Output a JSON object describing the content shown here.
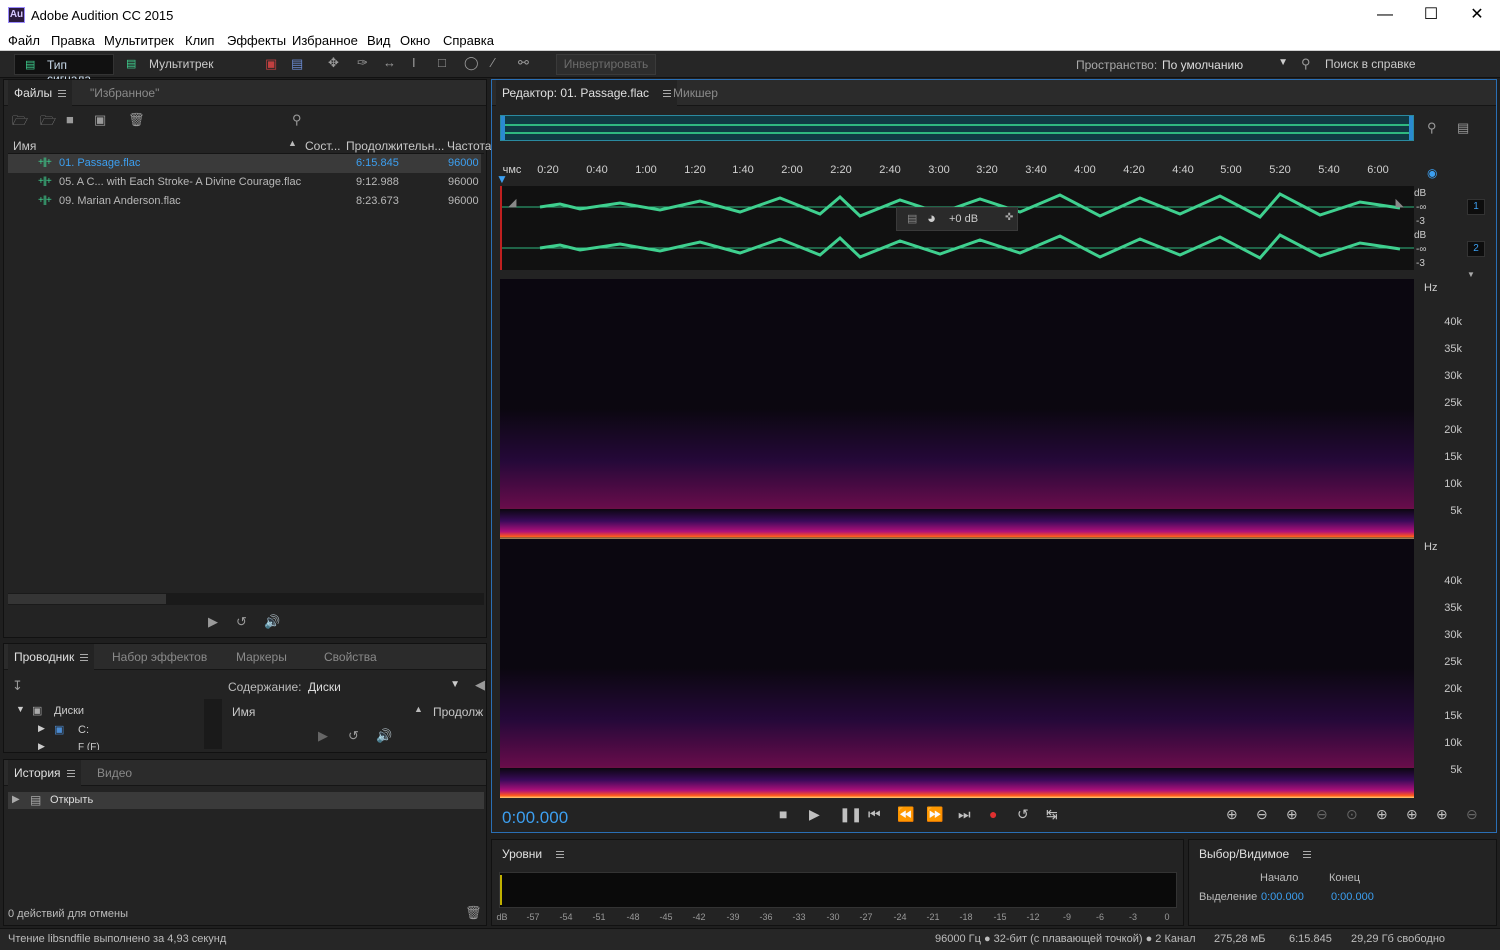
{
  "window": {
    "logo": "Au",
    "title": "Adobe Audition CC 2015"
  },
  "menu": [
    "Файл",
    "Правка",
    "Мультитрек",
    "Клип",
    "Эффекты",
    "Избранное",
    "Вид",
    "Окно",
    "Справка"
  ],
  "toolbar": {
    "waveform": "Тип сигнала",
    "multitrack": "Мультитрек",
    "invert": "Инвертировать",
    "workspace_label": "Пространство:",
    "workspace_value": "По умолчанию",
    "help_search": "Поиск в справке"
  },
  "files": {
    "tab_files": "Файлы",
    "tab_favorites": "\"Избранное\"",
    "columns": [
      "Имя",
      "Сост...",
      "Продолжительн...",
      "Частота"
    ],
    "rows": [
      {
        "name": "01. Passage.flac",
        "duration": "6:15.845",
        "rate": "96000"
      },
      {
        "name": "05. A C... with Each Stroke- A Divine Courage.flac",
        "duration": "9:12.988",
        "rate": "96000"
      },
      {
        "name": "09. Marian Anderson.flac",
        "duration": "8:23.673",
        "rate": "96000"
      }
    ]
  },
  "browser": {
    "tabs": [
      "Проводник",
      "Набор эффектов",
      "Маркеры",
      "Свойства"
    ],
    "content_label": "Содержание:",
    "content_value": "Диски",
    "tree": [
      "Диски",
      "C:",
      "F (F)"
    ],
    "columns": [
      "Имя",
      "Продолж"
    ]
  },
  "history": {
    "tabs": [
      "История",
      "Видео"
    ],
    "item": "Открыть",
    "undo": "0 действий для отмены"
  },
  "editor": {
    "tab": "Редактор: 01. Passage.flac",
    "mixer": "Микшер",
    "ruler": [
      "чмс",
      "0:20",
      "0:40",
      "1:00",
      "1:20",
      "1:40",
      "2:00",
      "2:20",
      "2:40",
      "3:00",
      "3:20",
      "3:40",
      "4:00",
      "4:20",
      "4:40",
      "5:00",
      "5:20",
      "5:40",
      "6:00"
    ],
    "db_labels": [
      "dB",
      "-∞",
      "-3"
    ],
    "channels": [
      "1",
      "2"
    ],
    "hud_gain": "+0 dB",
    "hz_unit": "Hz",
    "hz_labels": [
      "40k",
      "35k",
      "30k",
      "25k",
      "20k",
      "15k",
      "10k",
      "5k"
    ],
    "time": "0:00.000"
  },
  "levels": {
    "title": "Уровни",
    "scale": [
      "dB",
      "-57",
      "-54",
      "-51",
      "-48",
      "-45",
      "-42",
      "-39",
      "-36",
      "-33",
      "-30",
      "-27",
      "-24",
      "-21",
      "-18",
      "-15",
      "-12",
      "-9",
      "-6",
      "-3",
      "0"
    ]
  },
  "selection": {
    "title": "Выбор/Видимое",
    "start": "Начало",
    "end": "Конец",
    "row": "Выделение",
    "start_val": "0:00.000",
    "end_val": "0:00.000"
  },
  "status": {
    "msg": "Чтение libsndfile выполнено за 4,93 секунд",
    "format": "96000 Гц ● 32-бит (с плавающей точкой) ● 2 Канал",
    "size": "275,28 мБ",
    "duration": "6:15.845",
    "free": "29,29 Гб свободно"
  }
}
